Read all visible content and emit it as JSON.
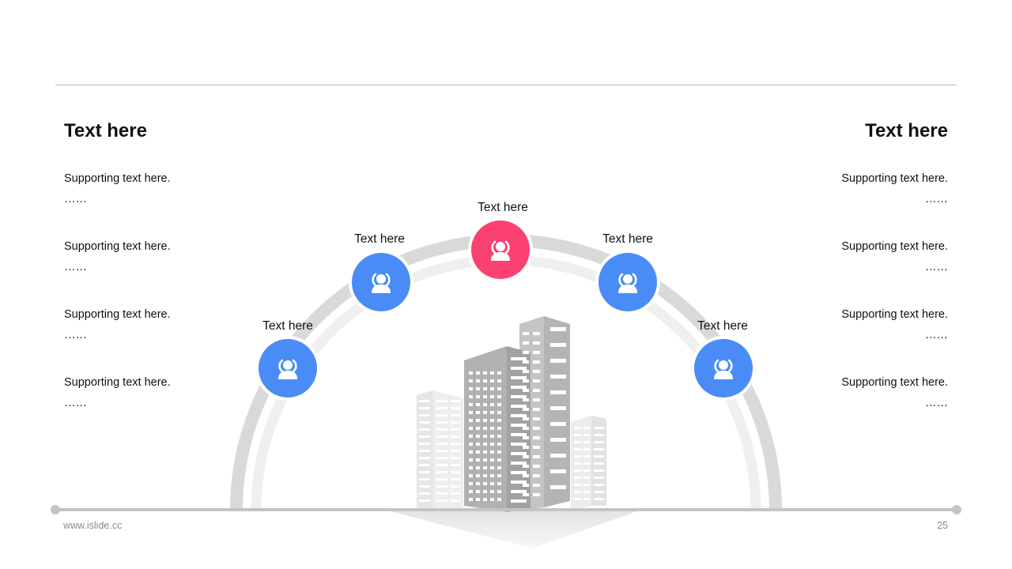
{
  "left": {
    "title": "Text here",
    "items": [
      {
        "text": "Supporting text here.",
        "more": "……"
      },
      {
        "text": "Supporting text here.",
        "more": "……"
      },
      {
        "text": "Supporting text here.",
        "more": "……"
      },
      {
        "text": "Supporting text here.",
        "more": "……"
      }
    ]
  },
  "right": {
    "title": "Text here",
    "items": [
      {
        "text": "Supporting text here.",
        "more": "……"
      },
      {
        "text": "Supporting text here.",
        "more": "……"
      },
      {
        "text": "Supporting text here.",
        "more": "……"
      },
      {
        "text": "Supporting text here.",
        "more": "……"
      }
    ]
  },
  "nodes": [
    {
      "label": "Text here",
      "icon": "user-group-icon"
    },
    {
      "label": "Text here",
      "icon": "user-group-icon"
    },
    {
      "label": "Text here",
      "icon": "user-group-icon"
    },
    {
      "label": "Text here",
      "icon": "user-group-icon"
    },
    {
      "label": "Text here",
      "icon": "user-group-icon"
    }
  ],
  "colors": {
    "node": "#4a8cf6",
    "accent": "#fb4170",
    "arc": "#d9d9d9",
    "building": "#a9a9a9"
  },
  "illustration": "city-buildings-icon",
  "footer": {
    "website": "www.islide.cc",
    "page_number": "25"
  }
}
